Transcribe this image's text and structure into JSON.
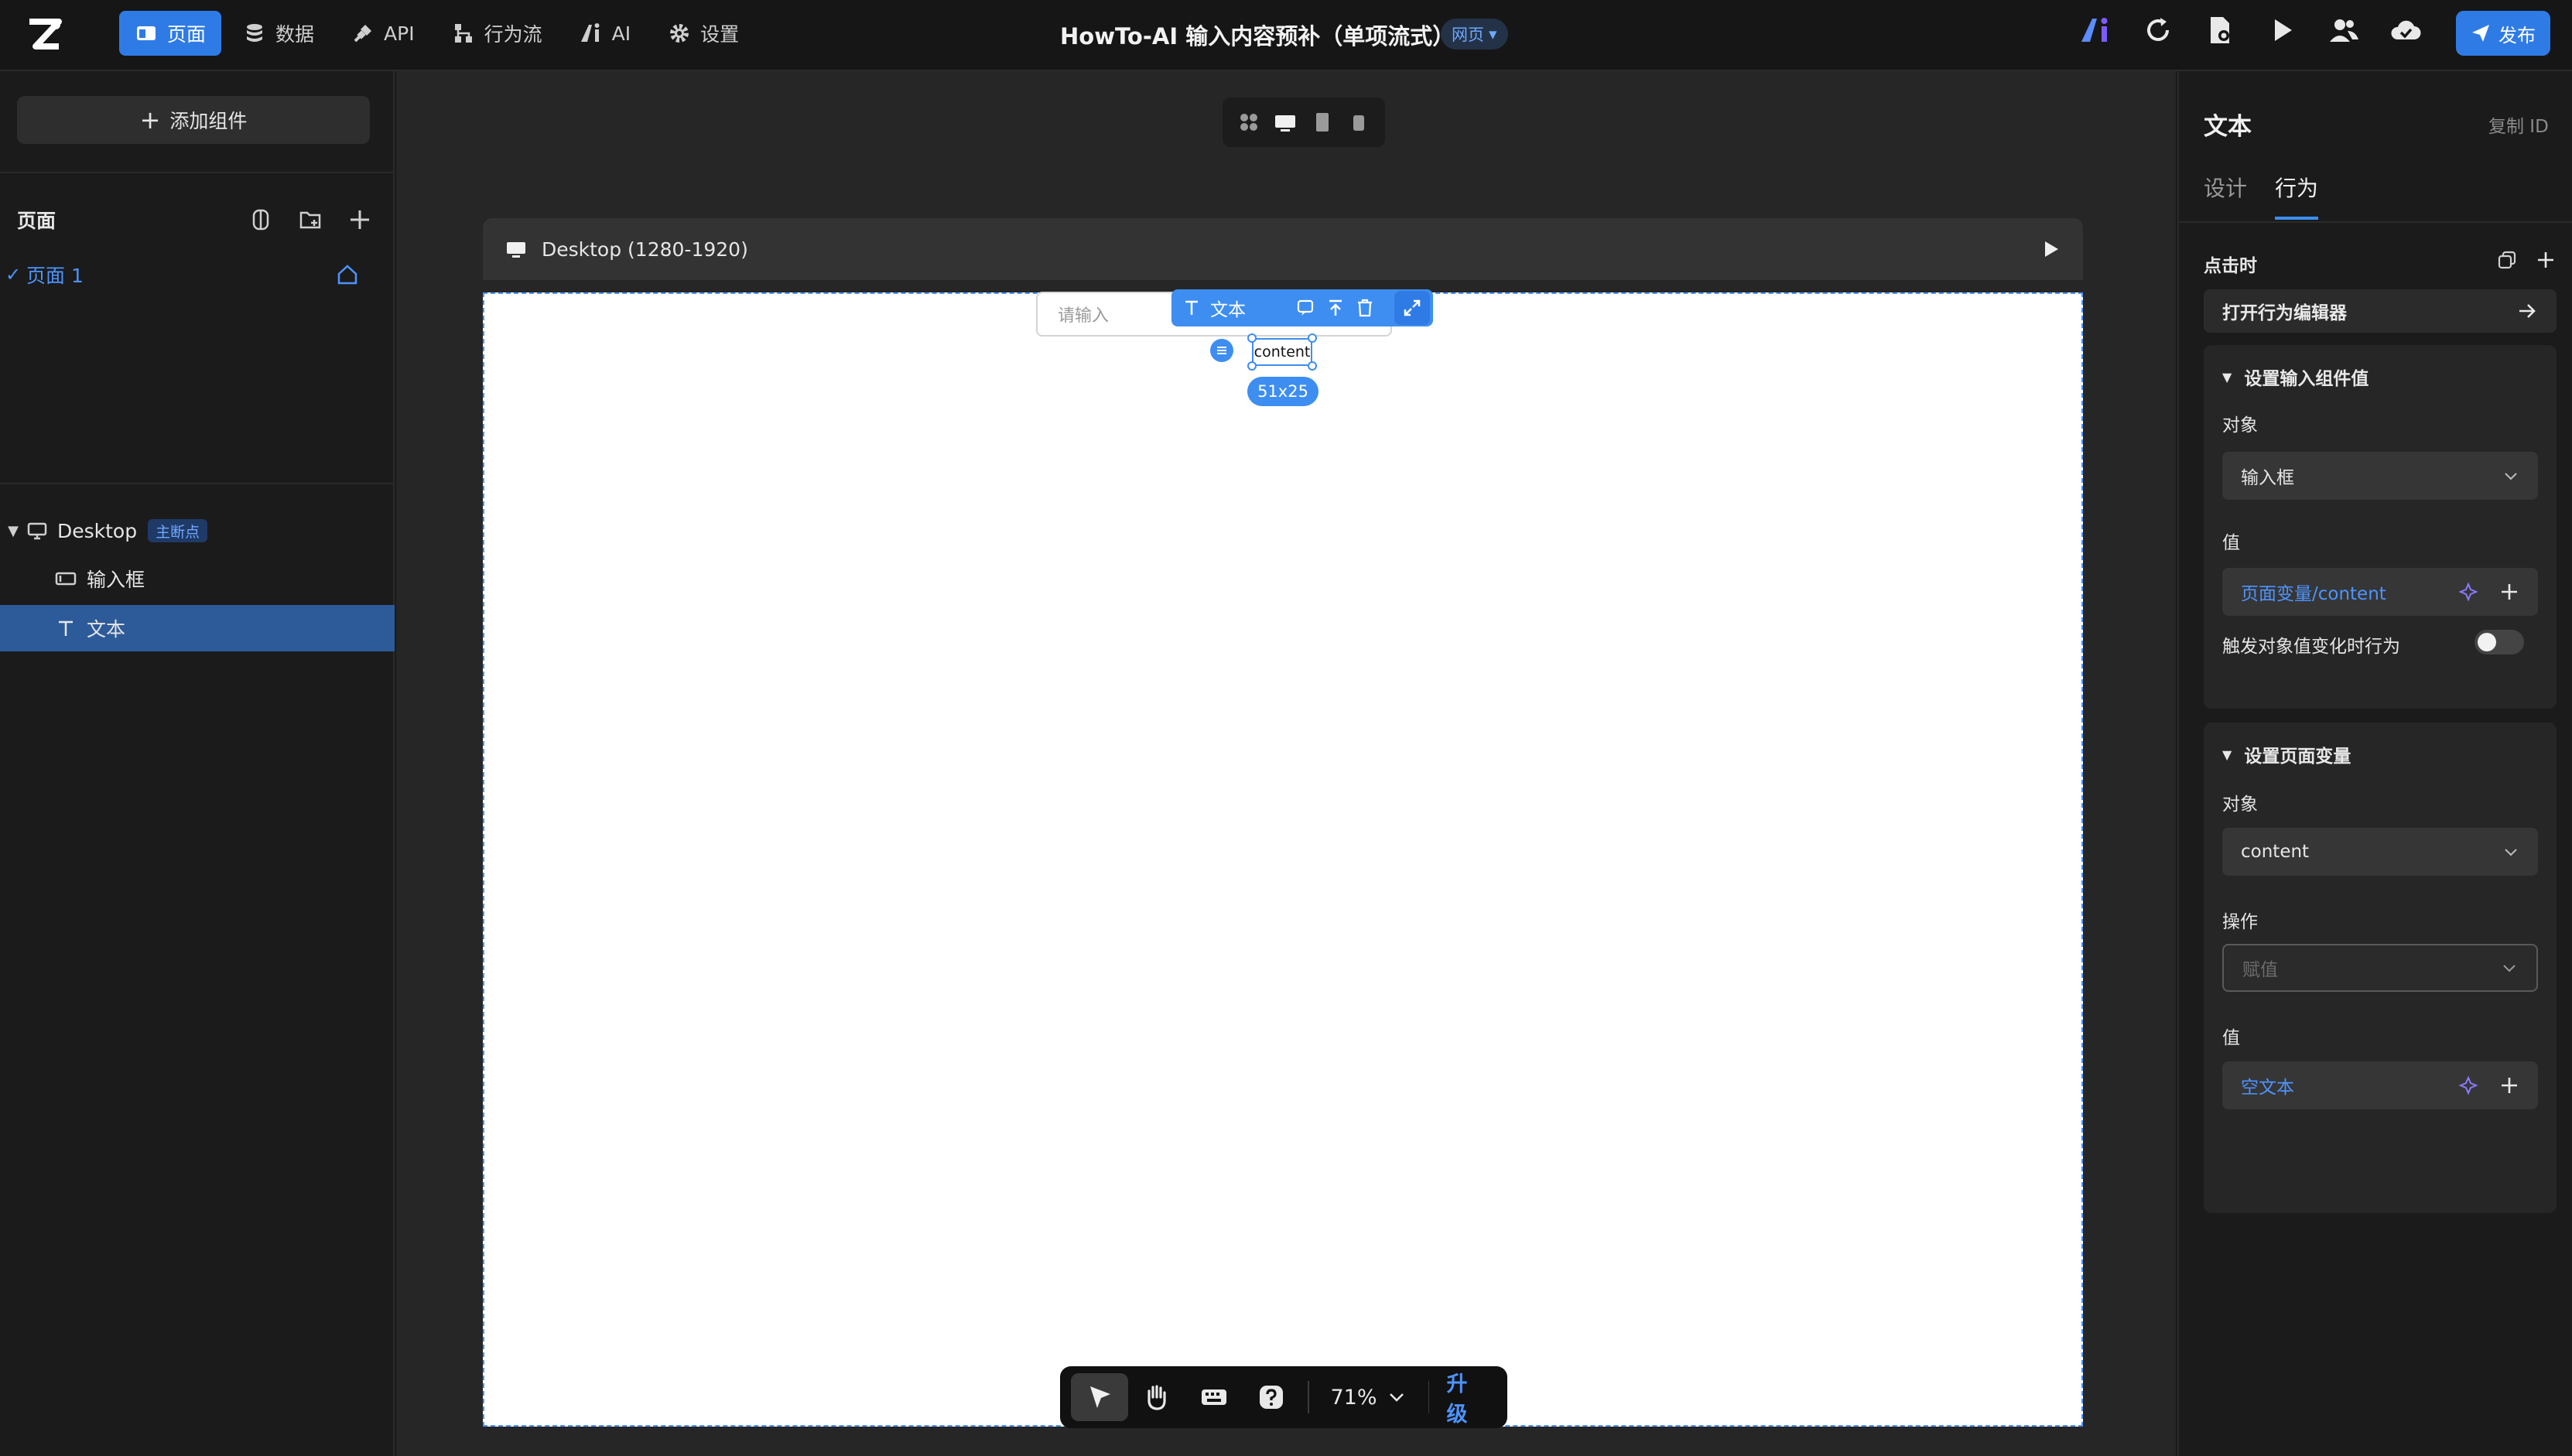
{
  "topbar": {
    "nav": [
      {
        "label": "页面",
        "icon": "page-icon",
        "active": true
      },
      {
        "label": "数据",
        "icon": "database-icon",
        "active": false
      },
      {
        "label": "API",
        "icon": "api-plug-icon",
        "active": false
      },
      {
        "label": "行为流",
        "icon": "flow-icon",
        "active": false
      },
      {
        "label": "AI",
        "icon": "ai-icon",
        "active": false
      },
      {
        "label": "设置",
        "icon": "gear-icon",
        "active": false
      }
    ],
    "app_title": "HowTo-AI 输入内容预补（单项流式）",
    "page_type": "网页",
    "publish_label": "发布",
    "colors": {
      "accent": "#2f7be6",
      "link": "#4d94ff"
    }
  },
  "left": {
    "add_component_label": "添加组件",
    "pages_title": "页面",
    "page_item": "页面 1",
    "layers": {
      "root": "Desktop",
      "root_badge": "主断点",
      "children": [
        {
          "label": "输入框",
          "icon": "input-layer-icon",
          "selected": false
        },
        {
          "label": "文本",
          "icon": "text-layer-icon",
          "selected": true
        }
      ]
    }
  },
  "canvas": {
    "frame_label": "Desktop (1280-1920)",
    "input_placeholder": "请输入",
    "toolbar_label": "文本",
    "selected_text": "content",
    "size_label": "51x25",
    "zoom_label": "71%",
    "upgrade_label": "升级"
  },
  "right": {
    "title": "文本",
    "copy_id_label": "复制 ID",
    "tabs": [
      "设计",
      "行为"
    ],
    "active_tab": "行为",
    "on_click_label": "点击时",
    "open_editor_label": "打开行为编辑器",
    "card1": {
      "title": "设置输入组件值",
      "target_label": "对象",
      "target_value": "输入框",
      "value_label": "值",
      "value": "页面变量/content",
      "trigger_label": "触发对象值变化时行为"
    },
    "card2": {
      "title": "设置页面变量",
      "target_label": "对象",
      "target_value": "content",
      "op_label": "操作",
      "op_placeholder": "赋值",
      "value_label": "值",
      "value": "空文本"
    }
  }
}
